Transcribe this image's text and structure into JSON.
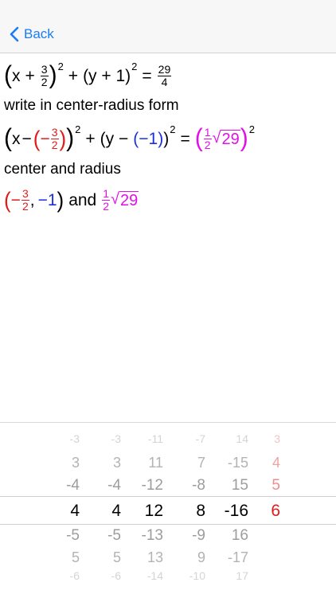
{
  "nav": {
    "back_label": "Back"
  },
  "problem": {
    "line1": {
      "x": "x",
      "plus": "+",
      "frac_num": "3",
      "frac_den": "2",
      "exp": "2",
      "y_term": "(y + 1)",
      "eq": "=",
      "rhs_num": "29",
      "rhs_den": "4"
    },
    "label1": "write in center-radius form",
    "line2": {
      "x": "x",
      "minus": "−",
      "neg": "−",
      "h_num": "3",
      "h_den": "2",
      "exp": "2",
      "plus": "+",
      "y": "(y −",
      "k": "(−1)",
      "close": ")",
      "eq": "=",
      "r_num": "1",
      "r_den": "2",
      "radicand": "29"
    },
    "label2": "center and radius",
    "line3": {
      "neg": "−",
      "h_num": "3",
      "h_den": "2",
      "comma": ",",
      "k": "−1",
      "and": "and",
      "r_num": "1",
      "r_den": "2",
      "radicand": "29"
    }
  },
  "picker": {
    "columns": [
      {
        "name": "col1",
        "values": [
          "-3",
          "3",
          "-4",
          "4",
          "-5",
          "5",
          "-6"
        ]
      },
      {
        "name": "col2",
        "values": [
          "-3",
          "3",
          "-4",
          "4",
          "-5",
          "5",
          "-6"
        ]
      },
      {
        "name": "col3",
        "values": [
          "-11",
          "11",
          "-12",
          "12",
          "-13",
          "13",
          "-14"
        ]
      },
      {
        "name": "col4",
        "values": [
          "-7",
          "7",
          "-8",
          "8",
          "-9",
          "9",
          "-10"
        ]
      },
      {
        "name": "col5",
        "values": [
          "14",
          "-15",
          "15",
          "-16",
          "16",
          "-17",
          "17"
        ]
      },
      {
        "name": "col6",
        "values": [
          "3",
          "4",
          "5",
          "6"
        ]
      }
    ],
    "selected_values": [
      "4",
      "4",
      "12",
      "8",
      "-16",
      "6"
    ]
  },
  "colors": {
    "accent": "#1a7cf5",
    "red": "#e01b1b",
    "blue": "#1b2ee0",
    "magenta": "#e010e6"
  }
}
